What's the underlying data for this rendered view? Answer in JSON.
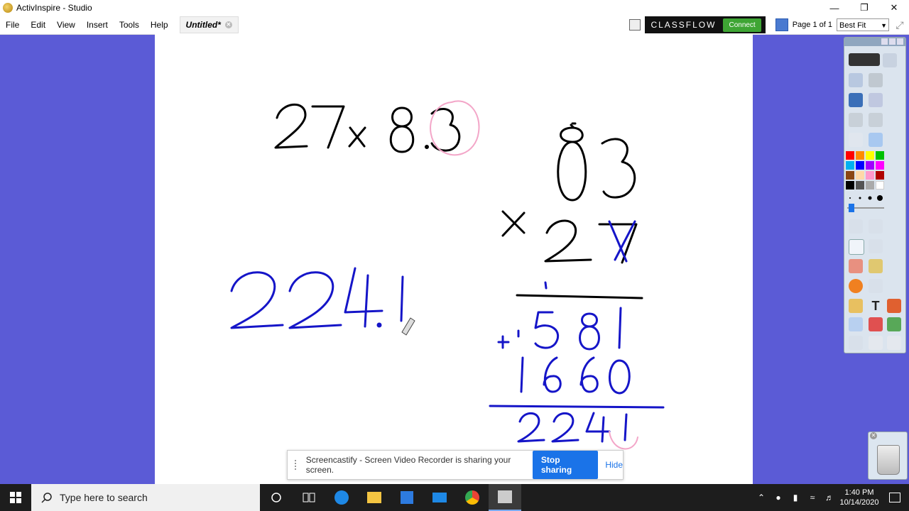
{
  "window": {
    "title": "ActivInspire - Studio"
  },
  "menu": {
    "items": [
      "File",
      "Edit",
      "View",
      "Insert",
      "Tools",
      "Help"
    ]
  },
  "doc_tab": {
    "label": "Untitled*"
  },
  "classflow": {
    "brand": "CLASSFLOW",
    "connect_label": "Connect"
  },
  "pager": {
    "label": "Page 1 of 1",
    "zoom": "Best Fit"
  },
  "screencastify": {
    "message": "Screencastify - Screen Video Recorder is sharing your screen.",
    "stop_label": "Stop sharing",
    "hide_label": "Hide"
  },
  "taskbar": {
    "search_placeholder": "Type here to search",
    "time": "1:40 PM",
    "date": "10/14/2020"
  },
  "colors": {
    "canvas_bg": "#5b5bd6",
    "ink_black": "#000000",
    "ink_blue": "#1515c8",
    "ink_pink": "#f3a6c8"
  },
  "toolbox": {
    "palette": [
      "#ff0000",
      "#ff8c00",
      "#ffff00",
      "#00c000",
      "#00b0f0",
      "#0000ff",
      "#a000ff",
      "#ff00ff",
      "#8b4513",
      "#ffd8a8",
      "#ff99cc",
      "#b00000",
      "#000000",
      "#555555",
      "#aaaaaa",
      "#ffffff"
    ]
  }
}
